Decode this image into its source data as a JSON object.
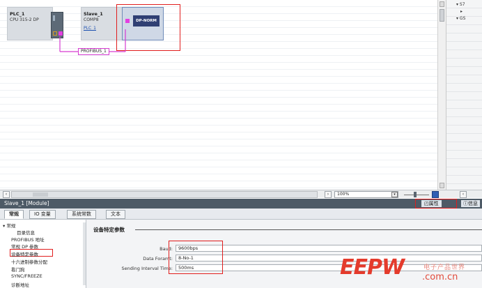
{
  "canvas": {
    "devices": [
      {
        "name": "PLC_1",
        "type": "CPU 315-2 DP"
      },
      {
        "name": "Slave_1",
        "type": "COMP8",
        "link": "PLC_1"
      }
    ],
    "module_label": "DP-NORM",
    "network_label": "PROFIBUS_1"
  },
  "right_panel": {
    "rows": [
      "S7",
      "GS"
    ]
  },
  "hbar": {
    "zoom": "100%"
  },
  "properties": {
    "title": "Slave_1 [Module]",
    "properties_tab": "属性",
    "info_tab": "信息",
    "tabs": [
      "常规",
      "IO 变量",
      "系统常数",
      "文本"
    ],
    "nav": {
      "group": "常规",
      "items": [
        "目录信息",
        "PROFIBUS 地址",
        "常规 DP 参数",
        "设备特定参数",
        "十六进制参数分配",
        "看门狗",
        "SYNC/FREEZE",
        "诊断地址"
      ]
    },
    "section_title": "设备特定参数",
    "fields": [
      {
        "label": "Baud:",
        "value": "9600bps"
      },
      {
        "label": "Data Foramt:",
        "value": "8-No-1"
      },
      {
        "label": "Sending Interval Time:",
        "value": "500ms"
      }
    ]
  },
  "watermark": {
    "main": "EEPW",
    "url": ".com.cn",
    "tagline": "电子产品世界"
  },
  "colors": {
    "profibus_line": "#d63bd1",
    "highlight_red": "#e11d1d",
    "module_blue": "#2f3f73",
    "header_bg": "#4d5a66"
  }
}
